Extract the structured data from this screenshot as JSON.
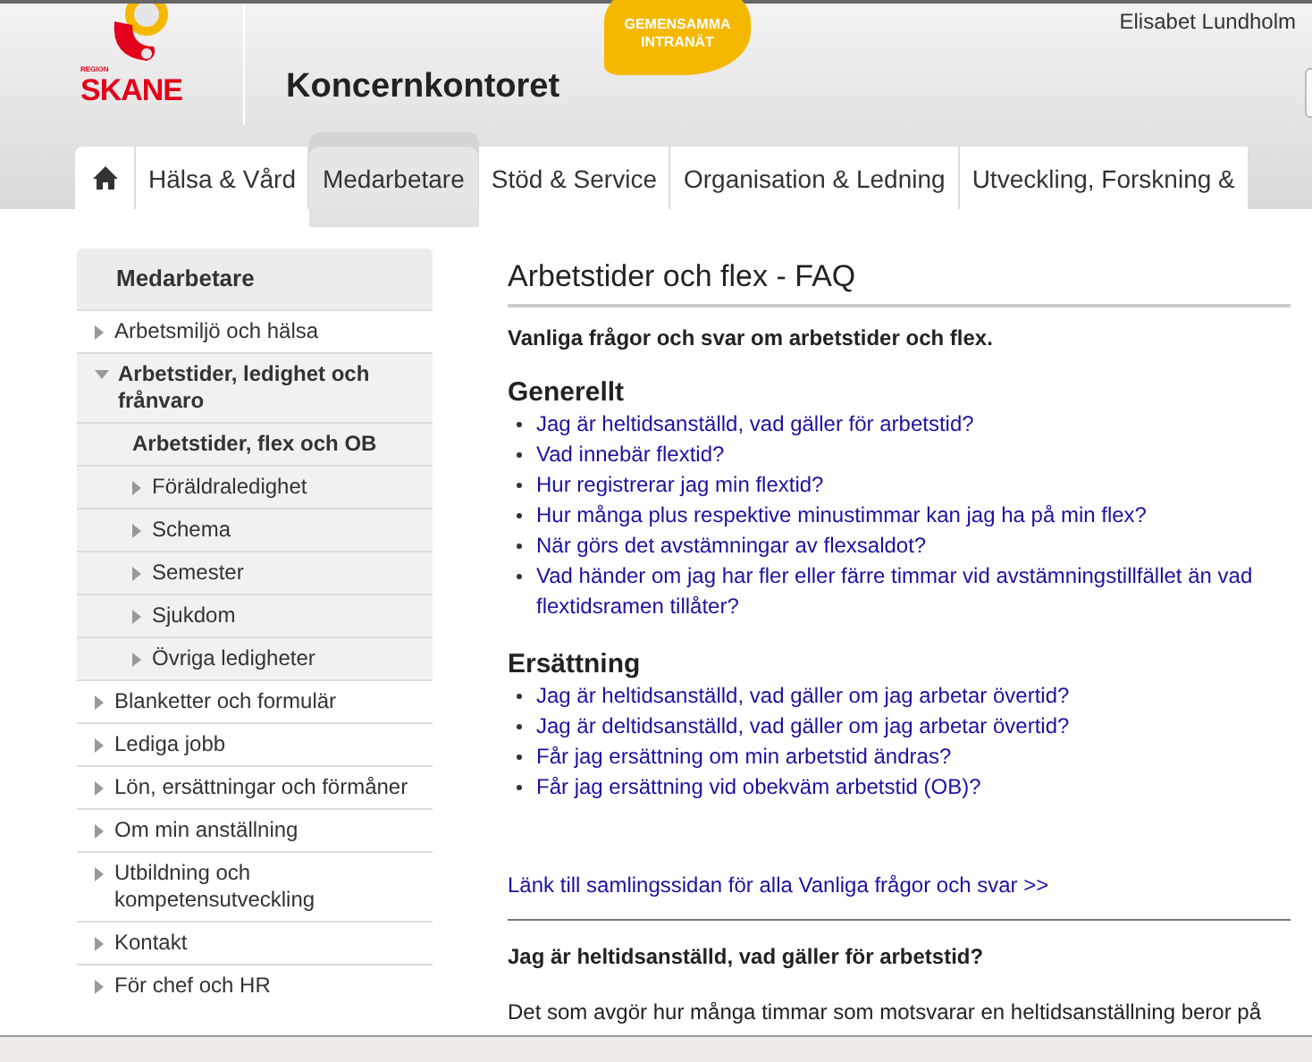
{
  "header": {
    "logo": {
      "small": "REGION",
      "name": "SKANE"
    },
    "site": "Koncernkontoret",
    "bubble": [
      "GEMENSAMMA",
      "INTRANÄT"
    ],
    "user": "Elisabet Lundholm"
  },
  "nav": [
    {
      "kind": "home",
      "selected": false
    },
    {
      "label": "Hälsa & Vård",
      "selected": false
    },
    {
      "label": "Medarbetare",
      "selected": true
    },
    {
      "label": "Stöd & Service",
      "selected": false
    },
    {
      "label": "Organisation & Ledning",
      "selected": false
    },
    {
      "label": "Utveckling, Forskning &",
      "selected": false
    }
  ],
  "sidebar": {
    "title": "Medarbetare",
    "items": [
      {
        "label": "Arbetsmiljö och hälsa",
        "expanded": false
      },
      {
        "label": "Arbetstider, ledighet och frånvaro",
        "expanded": true,
        "children": [
          {
            "label": "Arbetstider, flex och OB",
            "selected": true
          },
          {
            "label": "Föräldraledighet",
            "selected": false
          },
          {
            "label": "Schema",
            "selected": false
          },
          {
            "label": "Semester",
            "selected": false
          },
          {
            "label": "Sjukdom",
            "selected": false
          },
          {
            "label": "Övriga ledigheter",
            "selected": false
          }
        ]
      },
      {
        "label": "Blanketter och formulär",
        "expanded": false
      },
      {
        "label": "Lediga jobb",
        "expanded": false
      },
      {
        "label": "Lön, ersättningar och förmåner",
        "expanded": false
      },
      {
        "label": "Om min anställning",
        "expanded": false
      },
      {
        "label": "Utbildning och kompetensutveckling",
        "expanded": false
      },
      {
        "label": "Kontakt",
        "expanded": false
      },
      {
        "label": "För chef och HR",
        "expanded": false
      }
    ]
  },
  "content": {
    "title": "Arbetstider och flex - FAQ",
    "intro": "Vanliga frågor och svar om arbetstider och flex.",
    "sections": [
      {
        "heading": "Generellt",
        "links": [
          "Jag är heltidsanställd, vad gäller för arbetstid?",
          "Vad innebär flextid?",
          "Hur registrerar jag min flextid?",
          "Hur många plus respektive minustimmar kan jag ha på min flex?",
          "När görs det avstämningar av flexsaldot?",
          "Vad händer om jag har fler eller färre timmar vid avstämningstillfället än vad flextidsramen tillåter?"
        ]
      },
      {
        "heading": "Ersättning",
        "links": [
          "Jag är heltidsanställd, vad gäller om jag arbetar övertid?",
          "Jag är deltidsanställd, vad gäller om jag arbetar övertid?",
          "Får jag ersättning om min arbetstid ändras?",
          "Får jag ersättning vid obekväm arbetstid (OB)?"
        ]
      }
    ],
    "all_link": "Länk till samlingssidan för alla Vanliga frågor och svar >>",
    "answer_heading": "Jag är heltidsanställd, vad gäller för arbetstid?",
    "answer_text": "Det som avgör hur många timmar som motsvarar en heltidsanställning beror på"
  }
}
